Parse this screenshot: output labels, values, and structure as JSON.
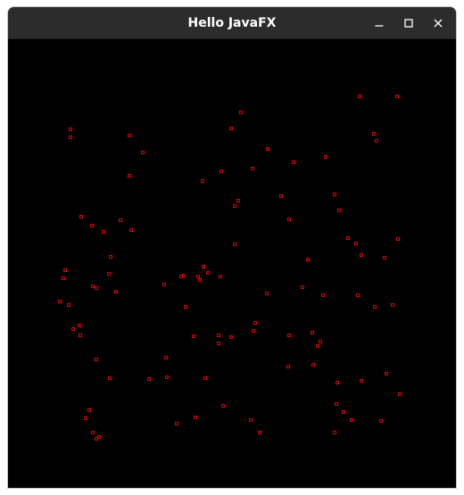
{
  "window": {
    "title": "Hello JavaFX"
  },
  "controls": {
    "minimize_icon": "minimize-icon",
    "maximize_icon": "maximize-icon",
    "close_icon": "close-icon"
  },
  "colors": {
    "titlebar_bg": "#2c2c2c",
    "canvas_bg": "#000000",
    "dot_color": "#e00000",
    "title_text": "#ffffff"
  },
  "canvas": {
    "dot_count": 118
  }
}
